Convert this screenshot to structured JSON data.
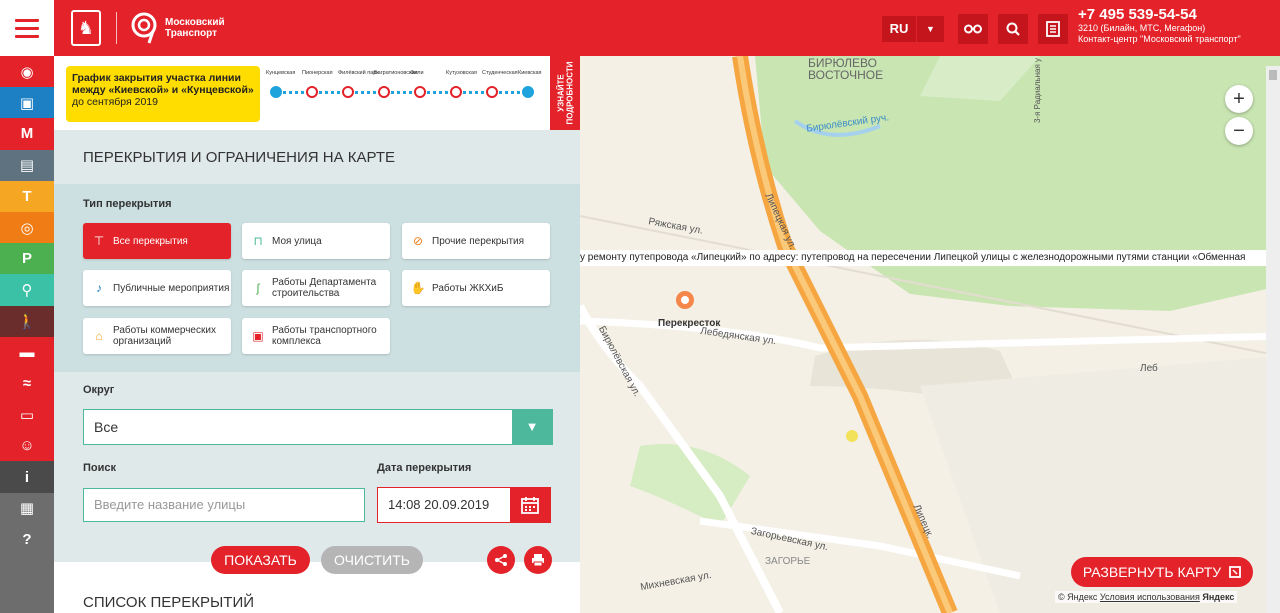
{
  "header": {
    "logo_text": "Московский Транспорт",
    "lang": "RU",
    "phone": "+7 495 539-54-54",
    "phone_sub1": "3210 (Билайн, МТС, Мегафон)",
    "phone_sub2": "Контакт-центр \"Московский транспорт\"",
    "colors": {
      "brand": "#e3222a",
      "accent": "#4db89c"
    }
  },
  "sidebar": {
    "items": [
      {
        "name": "mosgortrans-icon",
        "color": "#e3222a",
        "glyph": "◉"
      },
      {
        "name": "bus-icon",
        "color": "#1d7fc4",
        "glyph": "▣"
      },
      {
        "name": "metro-icon",
        "color": "#e3222a",
        "glyph": "M"
      },
      {
        "name": "trolleybus-icon",
        "color": "#5e7280",
        "glyph": "▤"
      },
      {
        "name": "tram-icon",
        "color": "#f5a623",
        "glyph": "T"
      },
      {
        "name": "car-icon",
        "color": "#f07c16",
        "glyph": "◎"
      },
      {
        "name": "parking-icon",
        "color": "#4caf50",
        "glyph": "P"
      },
      {
        "name": "bicycle-icon",
        "color": "#3ac1a6",
        "glyph": "⚲"
      },
      {
        "name": "pedestrian-icon",
        "color": "#6b2c2c",
        "glyph": "🚶"
      },
      {
        "name": "truck-icon",
        "color": "#e3222a",
        "glyph": "▬"
      },
      {
        "name": "motorcycle-icon",
        "color": "#e3222a",
        "glyph": "≈"
      },
      {
        "name": "taxi-icon",
        "color": "#e3222a",
        "glyph": "▭"
      },
      {
        "name": "feedback-icon",
        "color": "#e3222a",
        "glyph": "☺"
      },
      {
        "name": "info-icon",
        "color": "#4a4a4a",
        "glyph": "i"
      },
      {
        "name": "document-icon",
        "color": "#6d6d6d",
        "glyph": "▦"
      },
      {
        "name": "help-icon",
        "color": "#6d6d6d",
        "glyph": "?"
      }
    ]
  },
  "banner": {
    "title": "График закрытия участка линии между «Киевской» и «Кунцевской»",
    "subtitle": "до сентября 2019",
    "side_label_1": "УЗНАЙТЕ",
    "side_label_2": "ПОДРОБНОСТИ",
    "stations": [
      "Кунцевская",
      "Пионерская",
      "Филёвский парк",
      "Багратионовская",
      "Фили",
      "Кутузовская",
      "Студенческая",
      "Киевская"
    ]
  },
  "panel": {
    "title": "ПЕРЕКРЫТИЯ И ОГРАНИЧЕНИЯ НА КАРТЕ",
    "type_label": "Тип перекрытия",
    "chips": [
      "Все перекрытия",
      "Моя улица",
      "Прочие перекрытия",
      "Публичные мероприятия",
      "Работы Департамента строительства",
      "Работы ЖКХиБ",
      "Работы коммерческих организаций",
      "Работы транспортного комплекса"
    ],
    "district_label": "Округ",
    "district_value": "Все",
    "search_label": "Поиск",
    "search_placeholder": "Введите название улицы",
    "date_label": "Дата перекрытия",
    "date_value": "14:08 20.09.2019",
    "show_button": "ПОКАЗАТЬ",
    "clear_button": "ОЧИСТИТЬ",
    "list_title": "СПИСОК ПЕРЕКРЫТИЙ"
  },
  "map": {
    "ticker": "у ремонту путепровода «Липецкий» по адресу: путепровод на пересечении Липецкой улицы с железнодорожными путями станции «Обменная",
    "expand_button": "РАЗВЕРНУТЬ КАРТУ",
    "copyright": "© Яндекс",
    "terms": "Условия использования",
    "yandex": "Яндекс",
    "labels": {
      "district1": "БИРЮЛЕВО",
      "district2": "ВОСТОЧНОЕ",
      "stream": "Бирюлёвский руч.",
      "ryazhskaya": "Ряжская ул.",
      "lipetskaya1": "Липецкая ул.",
      "lipetskaya2": "Липецк.",
      "perekrestok": "Перекресток",
      "lebedyanskaya": "Лебедянская ул.",
      "biryulevskaya": "Бирюлёвская ул.",
      "zagorievskaya": "Загорьевская ул.",
      "zagorie": "ЗАГОРЬЕ",
      "mikhnevskaya": "Михневская ул.",
      "radialnaya": "3-я Радиальная у",
      "leb_short": "Леб"
    }
  }
}
